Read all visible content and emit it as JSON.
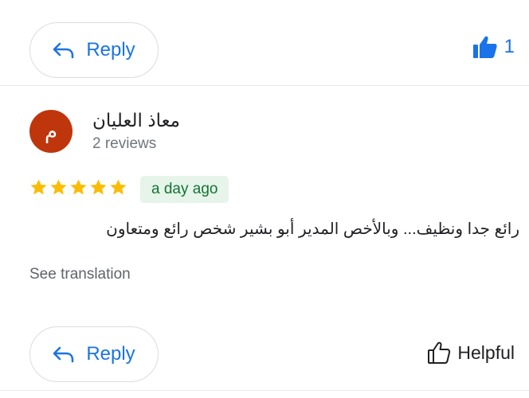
{
  "top": {
    "reply_label": "Reply",
    "like_count": "1"
  },
  "review": {
    "avatar_initial": "م",
    "author_name": "معاذ العليان",
    "author_reviews": "2 reviews",
    "rating": 5,
    "date": "a day ago",
    "text": "رائع جدا ونظيف... وبالأخص المدير أبو بشير شخص رائع ومتعاون",
    "see_translation": "See translation"
  },
  "bottom": {
    "reply_label": "Reply",
    "helpful_label": "Helpful"
  },
  "icons": {
    "reply": "reply-arrow-icon",
    "like": "thumbs-up-filled-icon",
    "helpful": "thumbs-up-outline-icon",
    "star": "star-icon"
  },
  "colors": {
    "accent": "#1a73e8",
    "avatar_bg": "#bf360c",
    "star": "#fbbc04",
    "date_badge_bg": "#e6f4ea",
    "date_badge_text": "#137333"
  }
}
